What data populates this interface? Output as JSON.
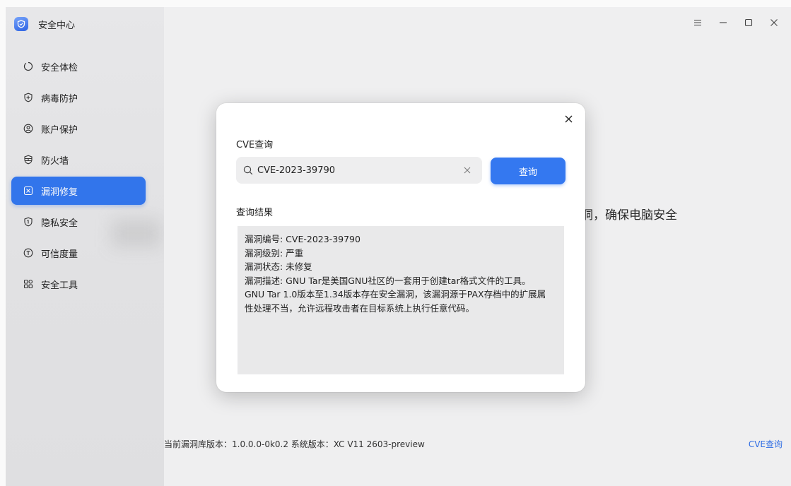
{
  "app": {
    "title": "安全中心",
    "logo_icon": "shield-logo-icon",
    "accent": "#3478f0"
  },
  "sidebar": {
    "items": [
      {
        "label": "安全体检",
        "icon": "scan-icon",
        "active": false
      },
      {
        "label": "病毒防护",
        "icon": "shield-plus-icon",
        "active": false
      },
      {
        "label": "账户保护",
        "icon": "account-icon",
        "active": false
      },
      {
        "label": "防火墙",
        "icon": "firewall-icon",
        "active": false
      },
      {
        "label": "漏洞修复",
        "icon": "vulnerability-icon",
        "active": true
      },
      {
        "label": "隐私安全",
        "icon": "privacy-icon",
        "active": false
      },
      {
        "label": "可信度量",
        "icon": "trust-icon",
        "active": false
      },
      {
        "label": "安全工具",
        "icon": "tools-grid-icon",
        "active": false
      }
    ]
  },
  "window_controls": [
    "menu-icon",
    "minimize-icon",
    "maximize-icon",
    "close-icon"
  ],
  "main": {
    "slogan_partial": "洞，确保电脑安全",
    "footer_info": "当前漏洞库版本：1.0.0.0-0k0.2  系统版本：XC V11 2603-preview",
    "cve_link": "CVE查询"
  },
  "dialog": {
    "title": "CVE查询",
    "search": {
      "value": "CVE-2023-39790",
      "placeholder": ""
    },
    "query_button": "查询",
    "result_label": "查询结果",
    "result": {
      "id_line": "漏洞编号: CVE-2023-39790",
      "level_line": "漏洞级别: 严重",
      "status_line": "漏洞状态: 未修复",
      "desc_line": "漏洞描述: GNU Tar是美国GNU社区的一套用于创建tar格式文件的工具。 GNU Tar 1.0版本至1.34版本存在安全漏洞，该漏洞源于PAX存档中的扩展属性处理不当，允许远程攻击者在目标系统上执行任意代码。"
    }
  }
}
